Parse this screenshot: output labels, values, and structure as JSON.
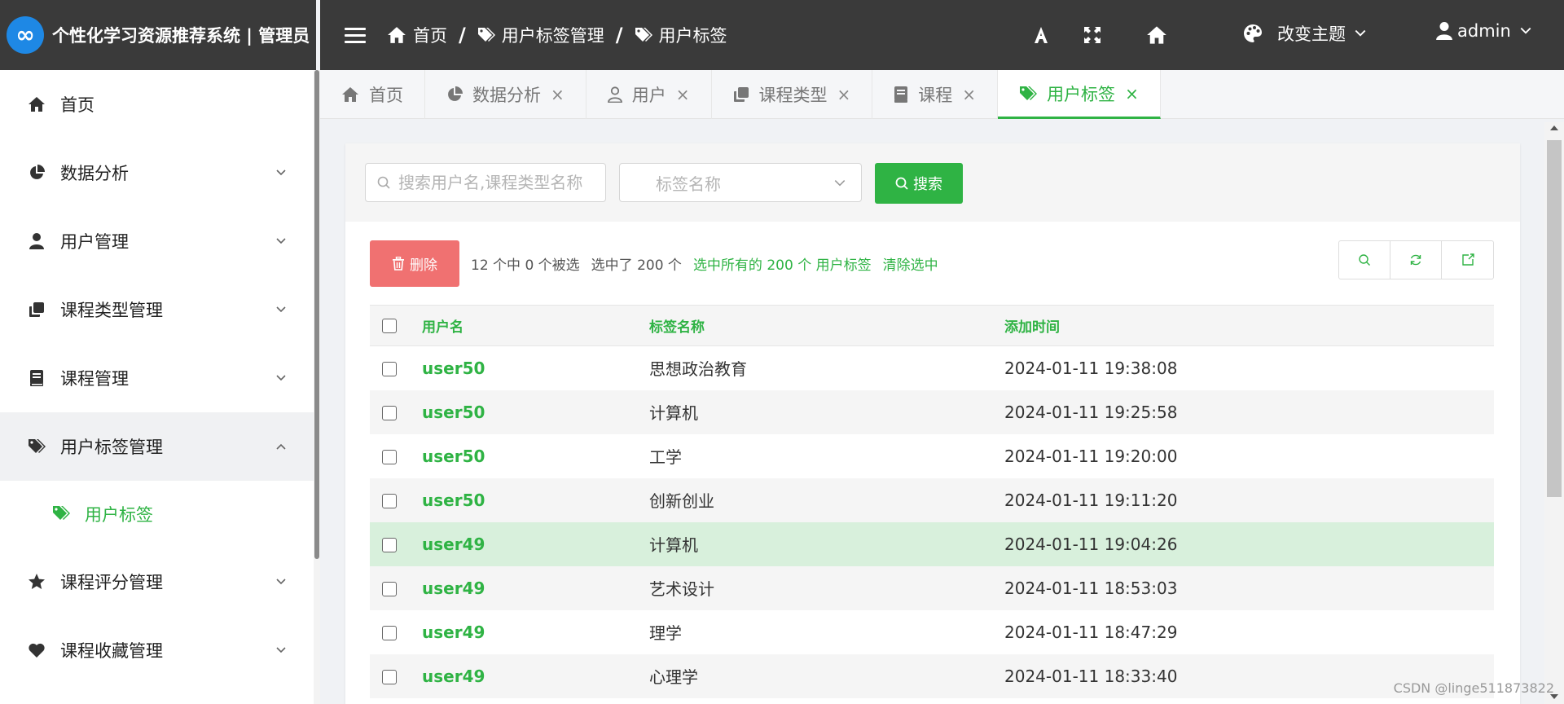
{
  "app": {
    "title": "个性化学习资源推荐系统 | 管理员",
    "logo_glyph": "∞"
  },
  "sidebar": {
    "items": [
      {
        "label": "首页",
        "icon": "home-icon",
        "expandable": false
      },
      {
        "label": "数据分析",
        "icon": "pie-chart-icon",
        "expandable": true
      },
      {
        "label": "用户管理",
        "icon": "user-icon",
        "expandable": true
      },
      {
        "label": "课程类型管理",
        "icon": "clone-icon",
        "expandable": true
      },
      {
        "label": "课程管理",
        "icon": "book-icon",
        "expandable": true
      },
      {
        "label": "用户标签管理",
        "icon": "tags-icon",
        "expandable": true,
        "open": true
      },
      {
        "label": "用户标签",
        "icon": "tags-icon",
        "sub": true
      },
      {
        "label": "课程评分管理",
        "icon": "star-icon",
        "expandable": true
      },
      {
        "label": "课程收藏管理",
        "icon": "heart-icon",
        "expandable": true
      }
    ]
  },
  "topbar": {
    "breadcrumbs": [
      "首页",
      "用户标签管理",
      "用户标签"
    ],
    "breadcrumb_sep": "/",
    "theme_label": "改变主题",
    "user_label": "admin"
  },
  "tabs": [
    {
      "label": "首页",
      "icon": "home-icon",
      "closable": false
    },
    {
      "label": "数据分析",
      "icon": "pie-chart-icon",
      "closable": true
    },
    {
      "label": "用户",
      "icon": "user-outline-icon",
      "closable": true
    },
    {
      "label": "课程类型",
      "icon": "clone-icon",
      "closable": true
    },
    {
      "label": "课程",
      "icon": "book-icon",
      "closable": true
    },
    {
      "label": "用户标签",
      "icon": "tags-icon",
      "closable": true,
      "active": true
    }
  ],
  "tab_close_glyph": "×",
  "filter": {
    "search_placeholder": "搜索用户名,课程类型名称",
    "tag_placeholder": "标签名称",
    "search_button": "搜索"
  },
  "toolbar": {
    "delete_label": "删除",
    "selection_count": "12 个中 0 个被选",
    "selected_total": "选中了 200 个",
    "select_all": "选中所有的 200 个 用户标签",
    "clear_selection": "清除选中"
  },
  "table": {
    "headers": [
      "用户名",
      "标签名称",
      "添加时间"
    ],
    "rows": [
      {
        "user": "user50",
        "tag": "思想政治教育",
        "time": "2024-01-11 19:38:08"
      },
      {
        "user": "user50",
        "tag": "计算机",
        "time": "2024-01-11 19:25:58"
      },
      {
        "user": "user50",
        "tag": "工学",
        "time": "2024-01-11 19:20:00"
      },
      {
        "user": "user50",
        "tag": "创新创业",
        "time": "2024-01-11 19:11:20"
      },
      {
        "user": "user49",
        "tag": "计算机",
        "time": "2024-01-11 19:04:26",
        "highlight": true
      },
      {
        "user": "user49",
        "tag": "艺术设计",
        "time": "2024-01-11 18:53:03"
      },
      {
        "user": "user49",
        "tag": "理学",
        "time": "2024-01-11 18:47:29"
      },
      {
        "user": "user49",
        "tag": "心理学",
        "time": "2024-01-11 18:33:40"
      }
    ]
  },
  "watermark": "CSDN @linge511873822",
  "colors": {
    "accent": "#2fb344",
    "topbar": "#3a3a3a",
    "danger": "#f07171",
    "highlight_row": "#d8f0dc"
  }
}
